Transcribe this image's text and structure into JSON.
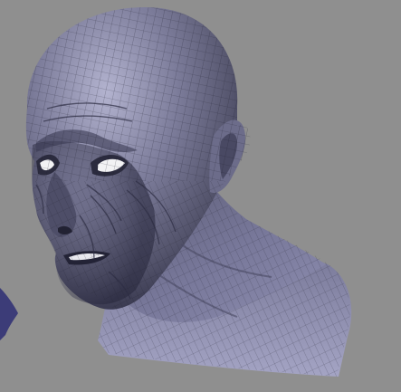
{
  "viewport": {
    "background_color": "#8f8f8f",
    "model": {
      "name": "sculpted-head-bust",
      "base_color": "#6a6a86",
      "shadow_color": "#2c2c40",
      "highlight_color": "#b6b6d2",
      "wire_color": "#1d1d2b",
      "shows_wireframe": true
    },
    "offscreen_object": {
      "name": "partial-object-left-edge",
      "color": "#3c3c78"
    }
  }
}
